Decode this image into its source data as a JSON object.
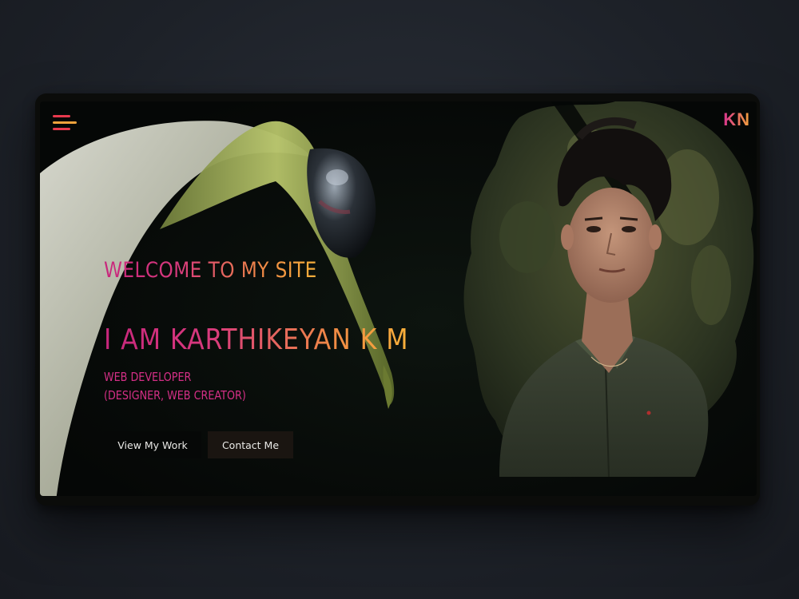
{
  "header": {
    "menu_icon": "hamburger-menu-icon",
    "logo_text": "KN"
  },
  "hero": {
    "welcome": "WELCOME TO MY SITE",
    "name": "I AM KARTHIKEYAN K M",
    "role_line1": "WEB DEVELOPER",
    "role_line2": "(DESIGNER, WEB CREATOR)",
    "buttons": {
      "view_work": "View My Work",
      "contact": "Contact Me"
    }
  },
  "colors": {
    "gradient_start": "#c7267c",
    "gradient_end": "#f8b03a",
    "menu_red": "#e8394d",
    "menu_orange": "#f0a23c"
  }
}
